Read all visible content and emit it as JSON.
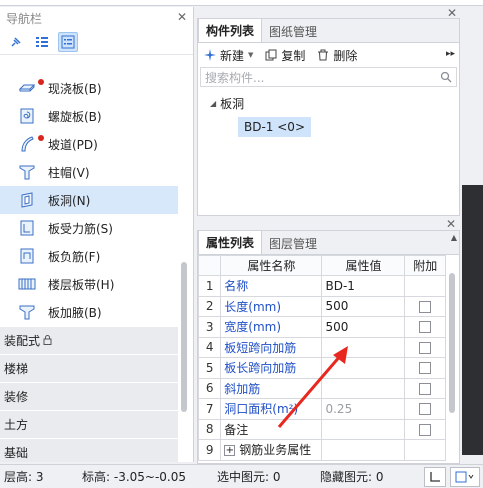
{
  "nav": {
    "title": "导航栏",
    "items": [
      {
        "label": "现浇板(B)",
        "icon": "slab-icon",
        "dot": true
      },
      {
        "label": "螺旋板(B)",
        "icon": "spiral-slab-icon",
        "dot": false
      },
      {
        "label": "坡道(PD)",
        "icon": "ramp-icon",
        "dot": true
      },
      {
        "label": "柱帽(V)",
        "icon": "column-cap-icon",
        "dot": false
      },
      {
        "label": "板洞(N)",
        "icon": "slab-hole-icon",
        "dot": false,
        "active": true
      },
      {
        "label": "板受力筋(S)",
        "icon": "slab-rebar-icon",
        "dot": false
      },
      {
        "label": "板负筋(F)",
        "icon": "negative-rebar-icon",
        "dot": false
      },
      {
        "label": "楼层板带(H)",
        "icon": "slab-strip-icon",
        "dot": false
      },
      {
        "label": "板加腋(B)",
        "icon": "slab-haunch-icon",
        "dot": false
      }
    ],
    "groups": [
      "装配式",
      "楼梯",
      "装修",
      "土方",
      "基础"
    ]
  },
  "component": {
    "tabs": [
      "构件列表",
      "图纸管理"
    ],
    "toolbar": {
      "new": "新建",
      "copy": "复制",
      "delete": "删除"
    },
    "search_placeholder": "搜索构件...",
    "tree": {
      "root": "板洞",
      "child": "BD-1 <0>"
    }
  },
  "properties": {
    "tabs": [
      "属性列表",
      "图层管理"
    ],
    "headers": [
      "属性名称",
      "属性值",
      "附加"
    ],
    "rows": [
      {
        "idx": "1",
        "name": "名称",
        "value": "BD-1",
        "blue": true,
        "checkbox": false
      },
      {
        "idx": "2",
        "name": "长度(mm)",
        "value": "500",
        "blue": true,
        "checkbox": true
      },
      {
        "idx": "3",
        "name": "宽度(mm)",
        "value": "500",
        "blue": true,
        "checkbox": true
      },
      {
        "idx": "4",
        "name": "板短跨向加筋",
        "value": "",
        "blue": true,
        "checkbox": true
      },
      {
        "idx": "5",
        "name": "板长跨向加筋",
        "value": "",
        "blue": true,
        "checkbox": true
      },
      {
        "idx": "6",
        "name": "斜加筋",
        "value": "",
        "blue": true,
        "checkbox": true
      },
      {
        "idx": "7",
        "name": "洞口面积(m²)",
        "value": "0.25",
        "blue": true,
        "checkbox": true,
        "gray": true
      },
      {
        "idx": "8",
        "name": "备注",
        "value": "",
        "blue": false,
        "checkbox": true
      },
      {
        "idx": "9",
        "name": "钢筋业务属性",
        "value": "",
        "blue": false,
        "checkbox": false,
        "expand": true
      }
    ]
  },
  "status": {
    "floor_height": "层高:  3",
    "elevation": "标高:  -3.05~-0.05",
    "selected": "选中图元:  0",
    "hidden": "隐藏图元:  0"
  },
  "colors": {
    "accent": "#1f4fc6",
    "selection": "#d8e8fb",
    "annotation_arrow": "#e8281e",
    "dot": "#d9261c"
  }
}
